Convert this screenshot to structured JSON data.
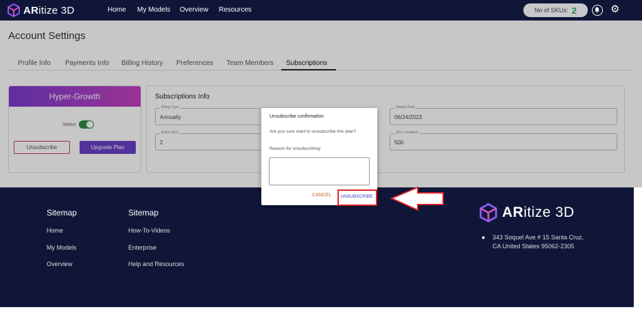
{
  "brand": {
    "name_bold": "AR",
    "name_rest": "itize 3D"
  },
  "nav": {
    "home": "Home",
    "models": "My Models",
    "overview": "Overview",
    "resources": "Resources"
  },
  "skus": {
    "label": "No of SKUs:",
    "value": "2"
  },
  "page": {
    "title": "Account Settings"
  },
  "tabs": [
    "Profile Info",
    "Payments Info",
    "Billing History",
    "Preferences",
    "Team Members",
    "Subscriptions"
  ],
  "plan": {
    "name": "Hyper-Growth",
    "status_label": "Status",
    "unsubscribe": "Unsubscribe",
    "upgrade": "Upgrade Plan"
  },
  "subscriptions": {
    "title": "Subscriptions Info",
    "fields": [
      {
        "label": "Billing Type",
        "value": "Annually"
      },
      {
        "label": "Active SKU",
        "value": "2"
      },
      {
        "label": "Started Date",
        "value": "06/24/2023"
      },
      {
        "label": "SKU Limitation",
        "value": "500"
      }
    ]
  },
  "modal": {
    "title": "Unsubscribe confirmation",
    "question": "Are you sure want to unsubscribe this plan?",
    "reason_label": "Reason for unsubscribing:",
    "cancel": "CANCEL",
    "confirm": "UNSUBSCRIBE"
  },
  "footer": {
    "col1": {
      "title": "Sitemap",
      "links": [
        "Home",
        "My Models",
        "Overview"
      ]
    },
    "col2": {
      "title": "Sitemap",
      "links": [
        "How-To-Videos",
        "Enterprise",
        "Help and Resources"
      ]
    },
    "address_line1": "343 Soquel Ave # 15 Santa Cruz,",
    "address_line2": "CA United States 95062-2305"
  },
  "colors": {
    "nav_bg": "#0f1638",
    "accent_purple": "#6a3fc9",
    "toggle_green": "#2f8c3f",
    "highlight_red": "#e0242b"
  }
}
